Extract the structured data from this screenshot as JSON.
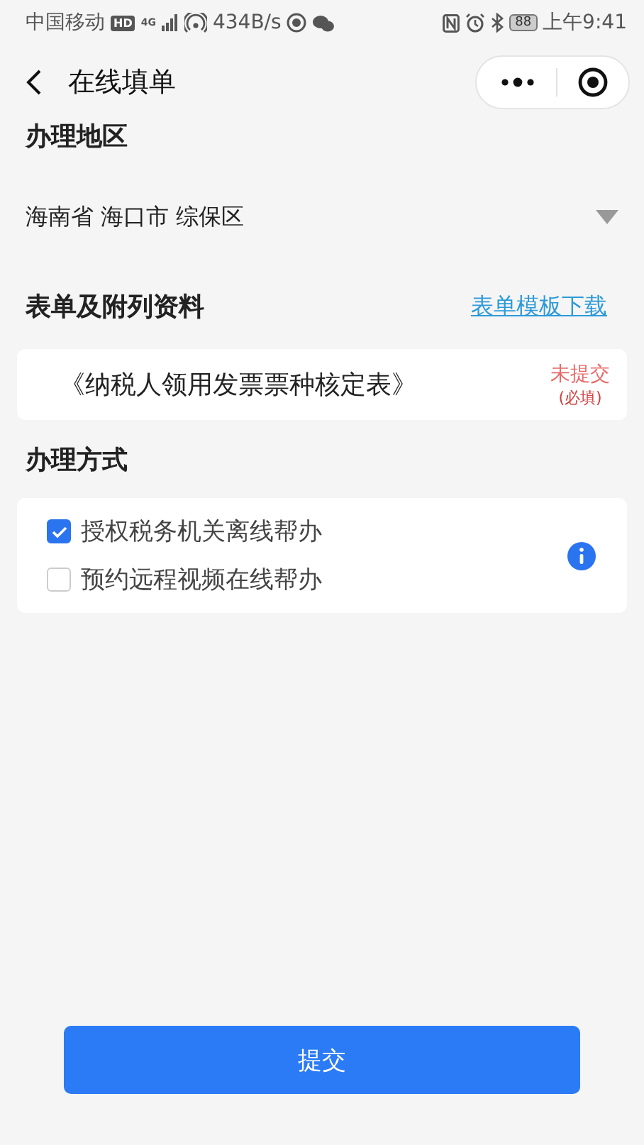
{
  "status_bar": {
    "carrier": "中国移动",
    "hd": "HD",
    "network": "4G",
    "speed": "434B/s",
    "battery": "88",
    "time": "上午9:41"
  },
  "nav": {
    "title": "在线填单"
  },
  "region": {
    "label": "办理地区",
    "value": "海南省 海口市 综保区"
  },
  "materials": {
    "label": "表单及附列资料",
    "link": "表单模板下载",
    "items": [
      {
        "title": "《纳税人领用发票票种核定表》",
        "status": "未提交",
        "note": "(必填)"
      }
    ]
  },
  "method": {
    "label": "办理方式",
    "options": [
      {
        "label": "授权税务机关离线帮办",
        "checked": true
      },
      {
        "label": "预约远程视频在线帮办",
        "checked": false
      }
    ]
  },
  "submit": "提交"
}
